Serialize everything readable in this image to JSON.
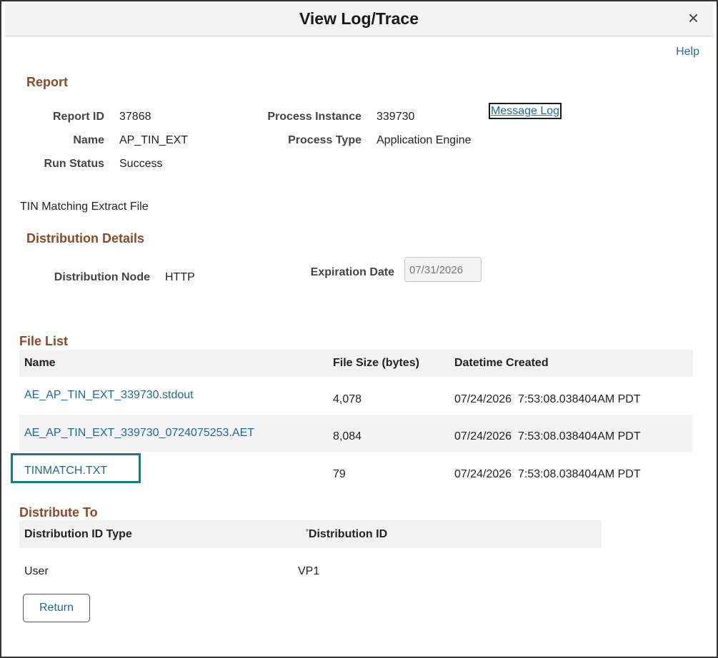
{
  "dialog": {
    "title": "View Log/Trace",
    "close_symbol": "×",
    "help_label": "Help"
  },
  "report": {
    "heading": "Report",
    "report_id_label": "Report ID",
    "report_id": "37868",
    "name_label": "Name",
    "name": "AP_TIN_EXT",
    "run_status_label": "Run Status",
    "run_status": "Success",
    "process_instance_label": "Process Instance",
    "process_instance": "339730",
    "process_type_label": "Process Type",
    "process_type": "Application Engine",
    "message_log_label": "Message Log",
    "description": "TIN Matching Extract File"
  },
  "distribution_details": {
    "heading": "Distribution Details",
    "node_label": "Distribution Node",
    "node": "HTTP",
    "expiration_label": "Expiration Date",
    "expiration_date": "07/31/2026"
  },
  "file_list": {
    "heading": "File List",
    "columns": [
      "Name",
      "File Size (bytes)",
      "Datetime Created"
    ],
    "rows": [
      {
        "name": "AE_AP_TIN_EXT_339730.stdout",
        "size": "4,078",
        "created": "07/24/2026  7:53:08.038404AM PDT"
      },
      {
        "name": "AE_AP_TIN_EXT_339730_0724075253.AET",
        "size": "8,084",
        "created": "07/24/2026  7:53:08.038404AM PDT"
      },
      {
        "name": "TINMATCH.TXT",
        "size": "79",
        "created": "07/24/2026  7:53:08.038404AM PDT"
      }
    ]
  },
  "distribute_to": {
    "heading": "Distribute To",
    "columns": [
      "Distribution ID Type",
      "Distribution ID"
    ],
    "required_marker": "*",
    "rows": [
      {
        "type": "User",
        "id": "VP1"
      }
    ]
  },
  "actions": {
    "return_label": "Return"
  },
  "colors": {
    "section_heading": "#8b4a2b",
    "link": "#1f6a9a",
    "focus_outline": "#1b7a86"
  }
}
